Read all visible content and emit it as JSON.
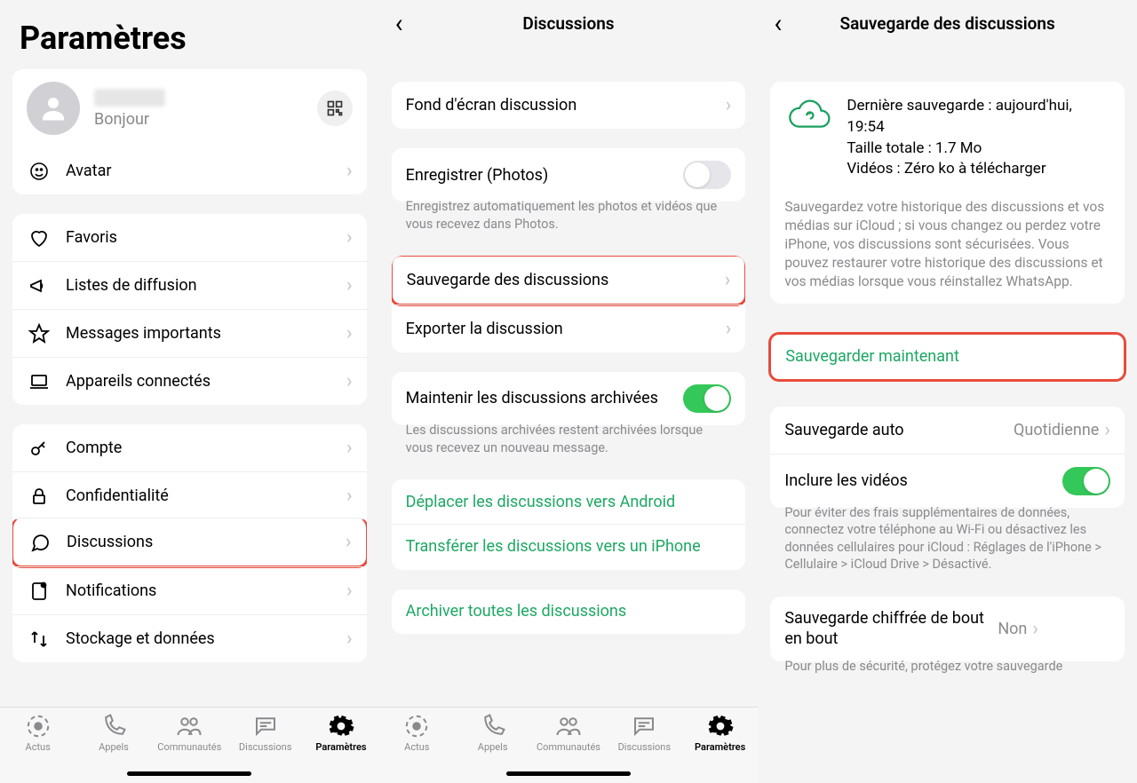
{
  "screen1": {
    "title": "Paramètres",
    "profile": {
      "status": "Bonjour"
    },
    "avatar": "Avatar",
    "group1": [
      "Favoris",
      "Listes de diffusion",
      "Messages importants",
      "Appareils connectés"
    ],
    "group2": [
      "Compte",
      "Confidentialité",
      "Discussions",
      "Notifications",
      "Stockage et données"
    ]
  },
  "screen2": {
    "title": "Discussions",
    "wallpaper": "Fond d'écran discussion",
    "save_photos": "Enregistrer (Photos)",
    "save_photos_note": "Enregistrez automatiquement les photos et vidéos que vous recevez dans Photos.",
    "backup": "Sauvegarde des discussions",
    "export": "Exporter la discussion",
    "keep_archived": "Maintenir les discussions archivées",
    "keep_archived_note": "Les discussions archivées restent archivées lorsque vous recevez un nouveau message.",
    "move_android": "Déplacer les discussions vers Android",
    "transfer_iphone": "Transférer les discussions vers un iPhone",
    "archive_all": "Archiver toutes les discussions"
  },
  "screen3": {
    "title": "Sauvegarde des discussions",
    "last_backup": "Dernière sauvegarde : aujourd'hui, 19:54",
    "total_size": "Taille totale : 1.7 Mo",
    "videos_line": "Vidéos : Zéro ko à télécharger",
    "desc": "Sauvegardez votre historique des discussions et vos médias sur iCloud ; si vous changez ou perdez votre iPhone, vos discussions sont sécurisées. Vous pouvez restaurer votre historique des discussions et vos médias lorsque vous réinstallez WhatsApp.",
    "backup_now": "Sauvegarder maintenant",
    "auto_backup": "Sauvegarde auto",
    "auto_backup_value": "Quotidienne",
    "include_videos": "Inclure les vidéos",
    "wifi_note": "Pour éviter des frais supplémentaires de données, connectez votre téléphone au Wi-Fi ou désactivez les données cellulaires pour iCloud : Réglages de l'iPhone > Cellulaire > iCloud Drive > Désactivé.",
    "e2e": "Sauvegarde chiffrée de bout en bout",
    "e2e_value": "Non",
    "e2e_note": "Pour plus de sécurité, protégez votre sauvegarde"
  },
  "tabs": [
    "Actus",
    "Appels",
    "Communautés",
    "Discussions",
    "Paramètres"
  ]
}
